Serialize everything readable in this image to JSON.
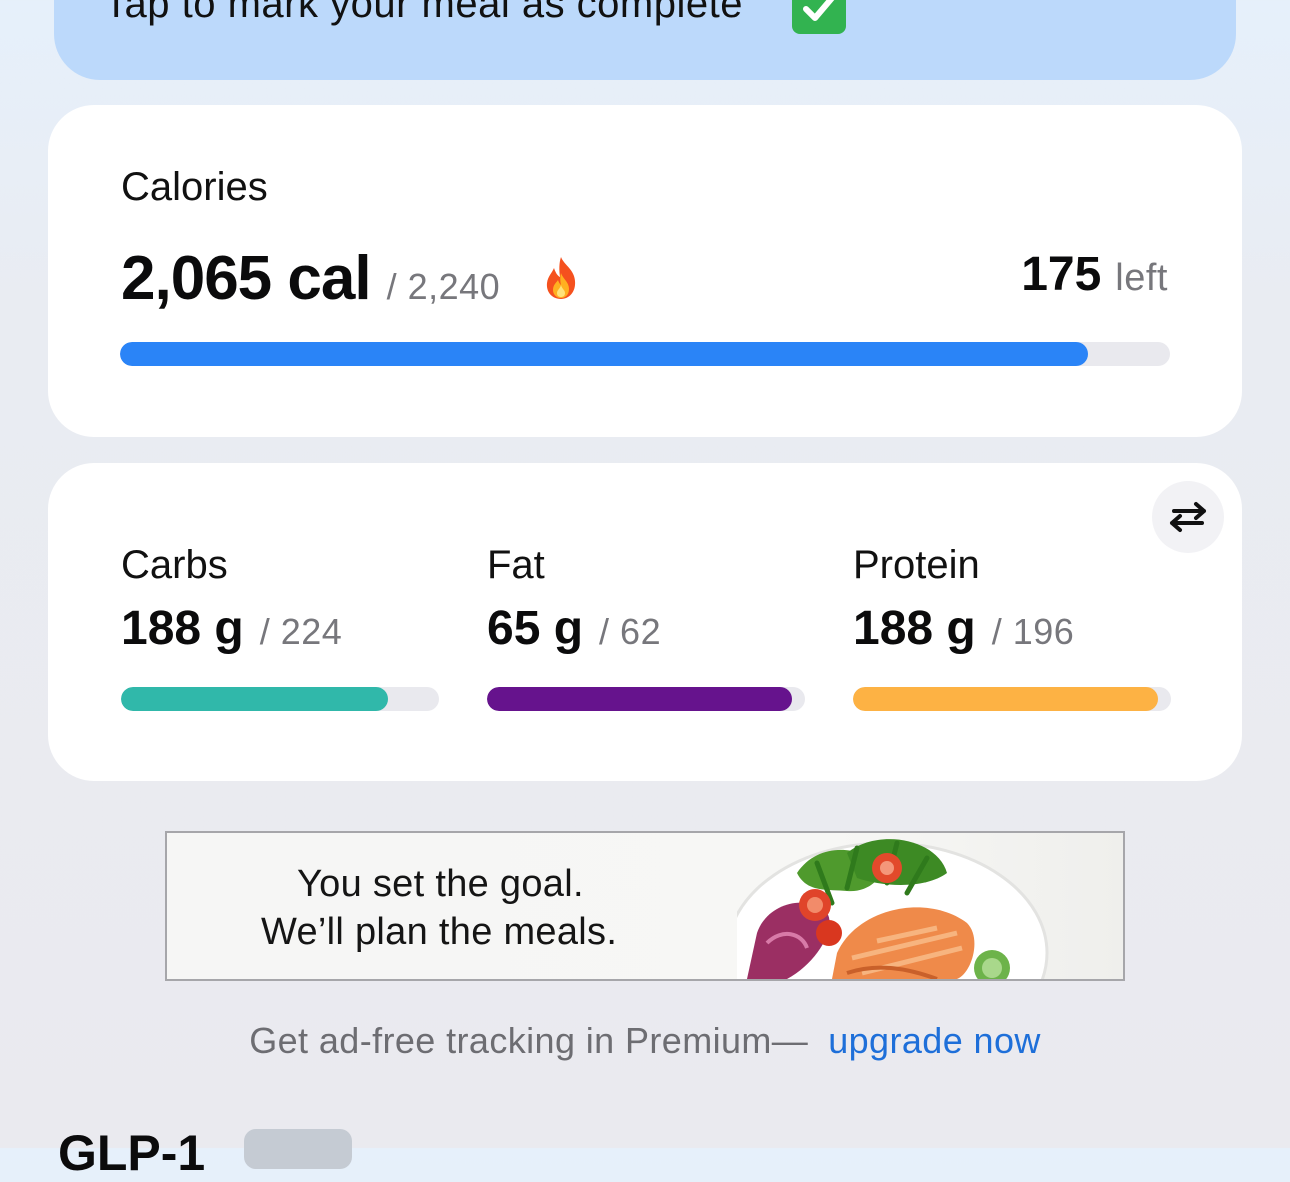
{
  "banner": {
    "text": "Tap to mark your meal as complete",
    "icon": "check-mark-button-icon"
  },
  "calories": {
    "title": "Calories",
    "consumed": "2,065 cal",
    "goal": "/ 2,240",
    "goal_icon": "fire-icon",
    "left_value": "175",
    "left_label": "left",
    "progress": 0.922,
    "bar_color": "#2a84f7"
  },
  "macros": {
    "swap_icon": "swap-arrows-icon",
    "items": [
      {
        "label": "Carbs",
        "value": "188 g",
        "goal": "/ 224",
        "progress": 0.84,
        "color": "#30b8aa"
      },
      {
        "label": "Fat",
        "value": "65 g",
        "goal": "/ 62",
        "progress": 0.96,
        "color": "#66138d"
      },
      {
        "label": "Protein",
        "value": "188 g",
        "goal": "/ 196",
        "progress": 0.96,
        "color": "#fdb244"
      }
    ]
  },
  "ad": {
    "line1": "You set the goal.",
    "line2": "We’ll plan the meals.",
    "image": "salmon-salad-plate"
  },
  "promo": {
    "text": "Get ad-free tracking in Premium—",
    "link": "upgrade now"
  },
  "next_section": {
    "title": "GLP-1"
  }
}
